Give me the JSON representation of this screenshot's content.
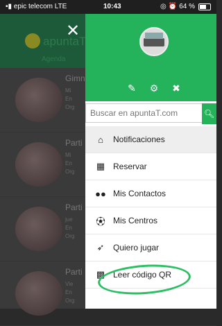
{
  "status": {
    "carrier": "epic telecom",
    "network": "LTE",
    "time": "10:43",
    "battery": "64 %"
  },
  "background": {
    "title": "apuntaT.c",
    "tab": "Agenda",
    "items": [
      {
        "title": "Gimn",
        "l1": "Mi",
        "l2": "En",
        "l3": "Org"
      },
      {
        "title": "Parti",
        "l1": "Mi",
        "l2": "En",
        "l3": "Org"
      },
      {
        "title": "Parti",
        "l1": "jue",
        "l2": "En",
        "l3": "Org"
      },
      {
        "title": "Parti",
        "l1": "Vie",
        "l2": "En",
        "l3": "Org"
      }
    ]
  },
  "drawer": {
    "close_icon": "close-icon",
    "header_icons": [
      "edit-icon",
      "settings-icon",
      "close-icon"
    ],
    "search": {
      "placeholder": "Buscar en apuntaT.com",
      "button_icon": "search-icon"
    },
    "menu": [
      {
        "label": "Notificaciones",
        "icon": "home-icon",
        "active": true
      },
      {
        "label": "Reservar",
        "icon": "calendar-icon"
      },
      {
        "label": "Mis Contactos",
        "icon": "users-icon"
      },
      {
        "label": "Mis Centros",
        "icon": "soccer-ball-icon"
      },
      {
        "label": "Quiero jugar",
        "icon": "rocket-icon"
      },
      {
        "label": "Leer código QR",
        "icon": "qr-code-icon"
      }
    ]
  },
  "colors": {
    "accent": "#24b35a",
    "highlight_circle": "#2bbf63"
  }
}
